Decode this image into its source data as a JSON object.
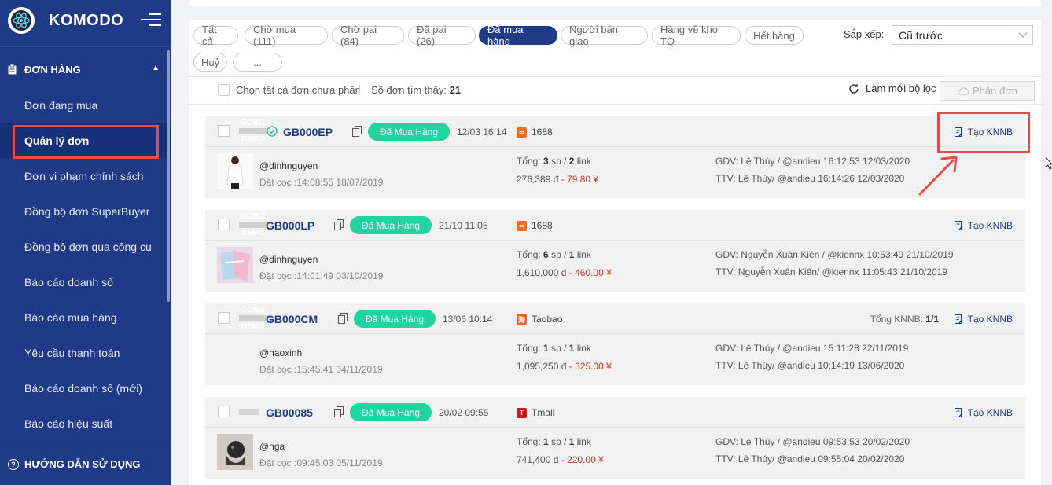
{
  "app": {
    "name": "KOMODO"
  },
  "sidebar": {
    "section_title": "ĐƠN HÀNG",
    "items": [
      {
        "label": "Đơn đang mua",
        "active": false
      },
      {
        "label": "Quản lý đơn",
        "active": true
      },
      {
        "label": "Đơn vi phạm chính sách",
        "active": false
      },
      {
        "label": "Đồng bộ đơn SuperBuyer",
        "active": false
      },
      {
        "label": "Đồng bộ đơn qua công cụ",
        "active": false
      },
      {
        "label": "Báo cáo doanh số",
        "active": false
      },
      {
        "label": "Báo cáo mua hàng",
        "active": false
      },
      {
        "label": "Yêu cầu thanh toán",
        "active": false
      },
      {
        "label": "Báo cáo doanh số (mới)",
        "active": false
      },
      {
        "label": "Báo cáo hiệu suất",
        "active": false
      }
    ],
    "footer": "HƯỚNG DẪN SỬ DỤNG"
  },
  "filters": {
    "chips": [
      {
        "label": "Tất cả",
        "active": false
      },
      {
        "label": "Chờ mua (111)",
        "active": false
      },
      {
        "label": "Chờ pai (84)",
        "active": false
      },
      {
        "label": "Đã pai (26)",
        "active": false
      },
      {
        "label": "Đã mua hàng",
        "active": true
      },
      {
        "label": "Người bán giao",
        "active": false
      },
      {
        "label": "Hàng về kho TQ",
        "active": false
      },
      {
        "label": "Hết hàng",
        "active": false
      },
      {
        "label": "Huỷ",
        "active": false
      },
      {
        "label": "...",
        "active": false
      }
    ],
    "sort_label": "Sắp xếp:",
    "sort_value": "Cũ trước"
  },
  "toolbar": {
    "select_all": "Chọn tất cả đơn chưa phân",
    "count_label": "Số đơn tìm thấy:",
    "count_value": "21",
    "reset": "Làm mới bộ lọc",
    "split": "Phân đơn"
  },
  "orders": [
    {
      "watermark": [
        "GOBIZ",
        "DEMO"
      ],
      "code": "GB000EP",
      "verified": true,
      "status": "Đã Mua Hàng",
      "date": "12/03 16:14",
      "source": "1688",
      "source_color": "#f26b1d",
      "total_knnb_label": "",
      "total_knnb_value": "",
      "action": "Tạo KNNB",
      "buyer": "@dinhnguyen",
      "deposit": "Đặt cọc :14:08:55 18/07/2019",
      "total_prefix": "Tổng:",
      "total_sp": "3",
      "total_mid": "sp /",
      "total_link": "2",
      "total_suffix": "link",
      "amount_vnd": "276,389 đ",
      "amount_cny": "- 79.80 ¥",
      "gdv": "GDV:   Lê Thúy / @andieu 16:12:53 12/03/2020",
      "ttv": "TTV:   Lê Thúy/ @andieu 16:14:26 12/03/2020"
    },
    {
      "watermark": [
        "GOBIZ",
        "DEMO"
      ],
      "code": "GB000LP",
      "verified": false,
      "status": "Đã Mua Hàng",
      "date": "21/10 11:05",
      "source": "1688",
      "source_color": "#f26b1d",
      "total_knnb_label": "",
      "total_knnb_value": "",
      "action": "Tạo KNNB",
      "buyer": "@dinhnguyen",
      "deposit": "Đặt cọc :14:01:49 03/10/2019",
      "total_prefix": "Tổng:",
      "total_sp": "6",
      "total_mid": "sp /",
      "total_link": "1",
      "total_suffix": "link",
      "amount_vnd": "1,610,000 đ",
      "amount_cny": "- 460.00 ¥",
      "gdv": "GDV:   Nguyễn Xuân Kiên / @kiennx 10:53:49 21/10/2019",
      "ttv": "TTV:   Nguyễn Xuân Kiên/ @kiennx 11:05:43 21/10/2019"
    },
    {
      "watermark": [
        "GOBIZ",
        "DEMO"
      ],
      "code": "GB000CM",
      "verified": false,
      "status": "Đã Mua Hàng",
      "date": "13/06 10:14",
      "source": "Taobao",
      "source_color": "#ff5a1f",
      "total_knnb_label": "Tổng KNNB:",
      "total_knnb_value": "1/1",
      "action": "Tạo KNNB",
      "buyer": "@haoxinh",
      "deposit": "Đặt cọc :15:45:41 04/11/2019",
      "total_prefix": "Tổng:",
      "total_sp": "1",
      "total_mid": "sp /",
      "total_link": "1",
      "total_suffix": "link",
      "amount_vnd": "1,095,250 đ",
      "amount_cny": "- 325.00 ¥",
      "gdv": "GDV:   Lê Thúy / @andieu 15:11:28 22/11/2019",
      "ttv": "TTV:   Lê Thúy/ @andieu 10:14:19 13/06/2020"
    },
    {
      "watermark": [],
      "code": "GB00085",
      "verified": false,
      "status": "Đã Mua Hàng",
      "date": "20/02 09:55",
      "source": "Tmall",
      "source_color": "#d0161d",
      "total_knnb_label": "",
      "total_knnb_value": "",
      "action": "Tạo KNNB",
      "buyer": "@nga",
      "deposit": "Đặt cọc :09:45:03 05/11/2019",
      "total_prefix": "Tổng:",
      "total_sp": "1",
      "total_mid": "sp /",
      "total_link": "1",
      "total_suffix": "link",
      "amount_vnd": "741,400 đ",
      "amount_cny": "- 220.00 ¥",
      "gdv": "GDV:   Lê Thúy / @andieu 09:53:53 20/02/2020",
      "ttv": "TTV:   Lê Thúy/ @andieu 09:55:04 20/02/2020"
    }
  ],
  "colors": {
    "sidebar": "#1f3b87",
    "accent": "#1f3b87",
    "status": "#1fd49d",
    "highlight": "#e54b4b",
    "price_cny": "#c0392b"
  }
}
